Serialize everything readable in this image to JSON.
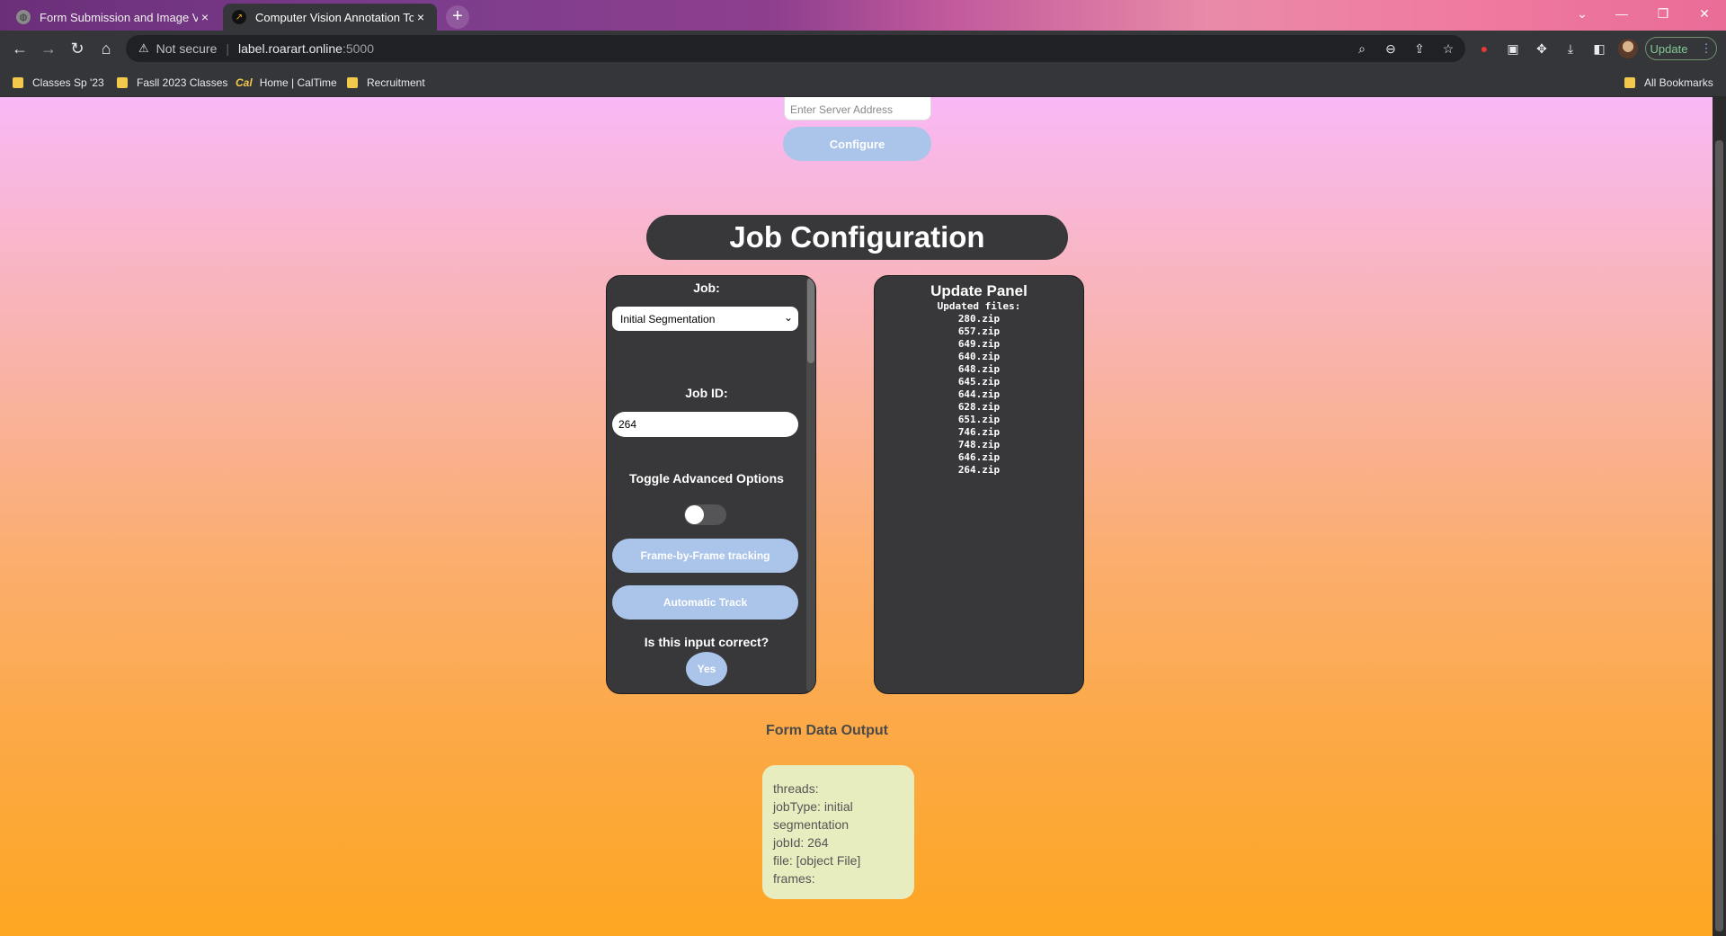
{
  "browser": {
    "tabs": [
      {
        "title": "Form Submission and Image Vie",
        "close": "×"
      },
      {
        "title": "Computer Vision Annotation Too",
        "close": "×"
      }
    ],
    "new_tab": "+",
    "omnibox": {
      "security_text": "Not secure",
      "host": "label.roarart.online",
      "port": ":5000"
    },
    "update_label": "Update",
    "bookmarks": [
      "Classes Sp '23",
      "Fasll 2023 Classes",
      "Home | CalTime",
      "Recruitment"
    ],
    "all_bookmarks": "All Bookmarks"
  },
  "server": {
    "placeholder": "Enter Server Address",
    "configure_label": "Configure"
  },
  "job_config": {
    "title": "Job Configuration",
    "job_label": "Job:",
    "job_selected": "Initial Segmentation",
    "job_id_label": "Job ID:",
    "job_id_value": "264",
    "advanced_label": "Toggle Advanced Options",
    "advanced_enabled": false,
    "frame_btn": "Frame-by-Frame tracking",
    "auto_btn": "Automatic Track",
    "confirm_label": "Is this input correct?",
    "yes_btn": "Yes"
  },
  "update_panel": {
    "title": "Update Panel",
    "subtitle": "Updated files:",
    "files": [
      "280.zip",
      "657.zip",
      "649.zip",
      "640.zip",
      "648.zip",
      "645.zip",
      "644.zip",
      "628.zip",
      "651.zip",
      "746.zip",
      "748.zip",
      "646.zip",
      "264.zip"
    ]
  },
  "form_output": {
    "title": "Form Data Output",
    "lines": [
      "threads:",
      "jobType: initial segmentation",
      "jobId: 264",
      "file: [object File]",
      "frames:"
    ]
  }
}
